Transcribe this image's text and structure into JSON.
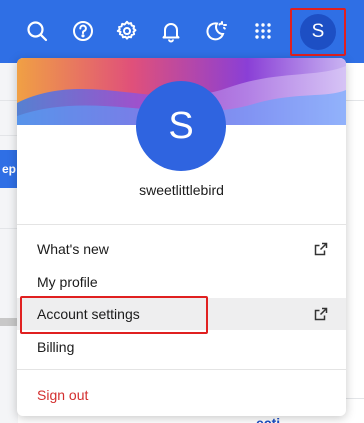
{
  "topbar": {
    "icons": [
      "search-icon",
      "help-icon",
      "settings-icon",
      "notifications-icon",
      "theme-toggle-icon",
      "apps-grid-icon"
    ],
    "avatar_initial": "S"
  },
  "background": {
    "tab_text": "ep",
    "bottom_text": "ecti"
  },
  "menu": {
    "avatar_initial": "S",
    "username": "sweetlittlebird",
    "items": [
      {
        "label": "What's new",
        "external": true
      },
      {
        "label": "My profile",
        "external": false
      },
      {
        "label": "Account settings",
        "external": true
      },
      {
        "label": "Billing",
        "external": false
      }
    ],
    "sign_out_label": "Sign out"
  },
  "colors": {
    "topbar": "#2f6fe5",
    "avatar": "#2f64e0",
    "sign_out": "#d32f2f",
    "highlight_box": "#e02020"
  }
}
